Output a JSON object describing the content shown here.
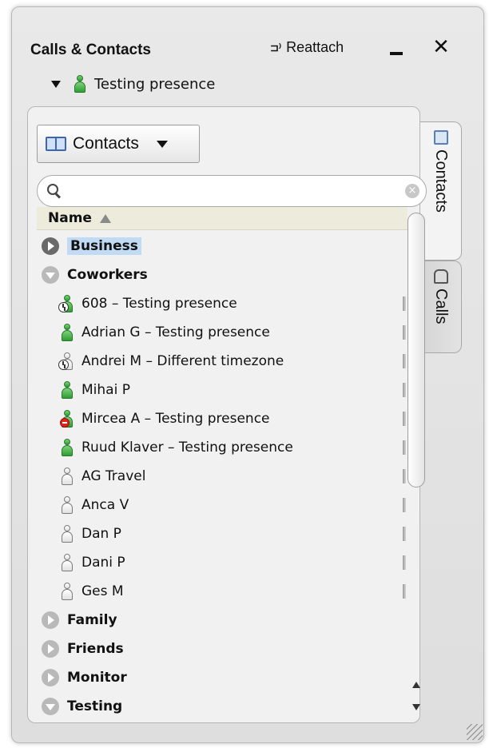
{
  "window": {
    "title": "Calls & Contacts",
    "reattach_label": "Reattach",
    "reattach_icon": "reattach-icon",
    "close_label": "✕"
  },
  "presence": {
    "label": "Testing presence",
    "status_color": "#2e9e33"
  },
  "contacts_panel": {
    "view_select": "Contacts",
    "search_placeholder": "",
    "search_value": "",
    "column_header": "Name",
    "sort": "ascending"
  },
  "tabs": [
    {
      "label": "Contacts",
      "icon": "contacts-book-icon",
      "active": true
    },
    {
      "label": "Calls",
      "icon": "phone-icon",
      "active": false
    }
  ],
  "list": {
    "groups_top": [
      {
        "label": "Business",
        "expanded": false,
        "selected": true
      },
      {
        "label": "Coworkers",
        "expanded": true,
        "selected": false
      }
    ],
    "contacts": [
      {
        "label": "608 – Testing presence",
        "presence": "away-online"
      },
      {
        "label": "Adrian G – Testing presence",
        "presence": "online"
      },
      {
        "label": "Andrei M – Different timezone",
        "presence": "away-offline"
      },
      {
        "label": "Mihai P",
        "presence": "online"
      },
      {
        "label": "Mircea A – Testing presence",
        "presence": "do-not-disturb"
      },
      {
        "label": "Ruud Klaver – Testing presence",
        "presence": "online"
      },
      {
        "label": "AG Travel",
        "presence": "offline"
      },
      {
        "label": "Anca V",
        "presence": "offline"
      },
      {
        "label": "Dan P",
        "presence": "offline"
      },
      {
        "label": "Dani P",
        "presence": "offline"
      },
      {
        "label": "Ges M",
        "presence": "offline"
      }
    ],
    "groups_bottom": [
      {
        "label": "Family",
        "expanded": false
      },
      {
        "label": "Friends",
        "expanded": false
      },
      {
        "label": "Monitor",
        "expanded": false
      },
      {
        "label": "Testing",
        "expanded": true
      }
    ]
  },
  "colors": {
    "selection": "#c2dbf5",
    "online": "#2e9e33",
    "dnd": "#e1231b",
    "header_bg": "#ecebdc"
  }
}
